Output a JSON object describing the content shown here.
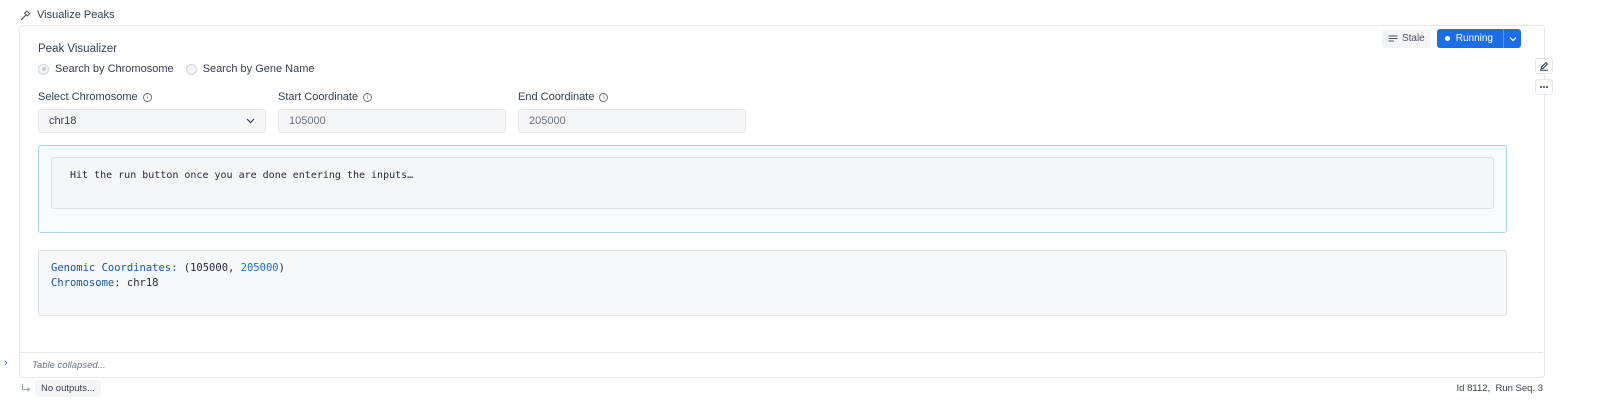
{
  "cell": {
    "title": "Visualize Peaks"
  },
  "toolbar": {
    "stale_label": "Stale",
    "run_label": "Running"
  },
  "widget": {
    "title": "Peak Visualizer",
    "radio_options": [
      "Search by Chromosome",
      "Search by Gene Name"
    ],
    "selected_index": 0,
    "fields": {
      "chromosome": {
        "label": "Select Chromosome",
        "value": "chr18"
      },
      "start": {
        "label": "Start Coordinate",
        "value": "105000"
      },
      "end": {
        "label": "End Coordinate",
        "value": "205000"
      }
    },
    "message": "Hit the run button once you are done entering the inputs…"
  },
  "output": {
    "coords_key": "Genomic Coordinates:",
    "coords_open": " (105000, ",
    "coords_end": "205000",
    "coords_close": ")",
    "chrom_key": "Chromosome:",
    "chrom_value": " chr18"
  },
  "table": {
    "collapsed_label": "Table collapsed..."
  },
  "footer": {
    "no_outputs": "No outputs...",
    "id_text": "Id 8112,  Run Seq. 3"
  },
  "icons": {
    "header": "hammer-icon",
    "stale": "sliders-icon",
    "running": "dot-icon",
    "run_menu": "chevron-down-icon",
    "edit": "pencil-icon",
    "more": "ellipsis-icon",
    "info": "info-icon",
    "select": "chevron-down-icon",
    "expand": "chevron-right-icon",
    "outputs": "arrow-return-icon"
  },
  "colors": {
    "primary": "#1d6ee6",
    "message_border": "#a5dbe9",
    "key": "#1857a4",
    "number": "#1a6fcf"
  }
}
